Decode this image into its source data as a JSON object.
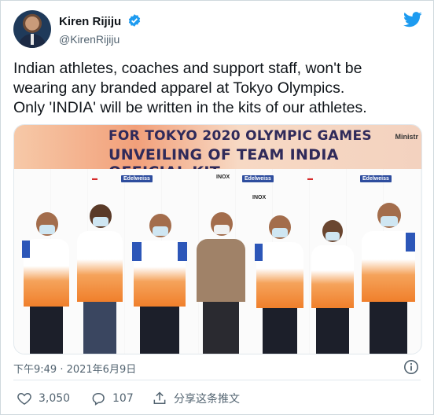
{
  "tweet": {
    "display_name": "Kiren Rijiju",
    "handle": "@KirenRijiju",
    "verified": true,
    "text_lines": [
      "Indian athletes, coaches and support staff, won't be",
      "wearing any branded apparel at Tokyo Olympics.",
      "Only 'INDIA' will be written in the kits of our athletes."
    ],
    "timestamp": "下午9:49 · 2021年6月9日",
    "likes": "3,050",
    "replies": "107",
    "share_label": "分享这条推文"
  },
  "photo": {
    "banner_line1": "FOR TOKYO 2020 OLYMPIC GAMES",
    "banner_line2": "UNVEILING OF TEAM INDIA OFFICIAL KIT",
    "ministry_text": "Ministr",
    "sponsor_logos": [
      "Edelweiss",
      "INOX",
      "Edelweiss",
      "Edelweiss",
      "INOX"
    ]
  },
  "colors": {
    "twitter_blue": "#1d9bf0",
    "secondary_text": "#536471",
    "kit_orange": "#f07f2b",
    "kit_blue": "#2c56b8"
  },
  "icons": {
    "bird": "twitter-bird-icon",
    "verified": "verified-badge-icon",
    "info": "info-icon",
    "like": "heart-icon",
    "reply": "reply-bubble-icon",
    "share": "share-icon"
  }
}
